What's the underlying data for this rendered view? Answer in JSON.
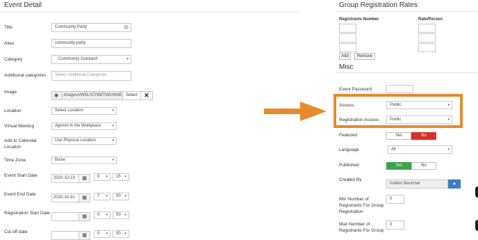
{
  "event_detail": {
    "heading": "Event Detail",
    "title_label": "Title",
    "title_value": "Community Party",
    "alias_label": "Alias",
    "alias_value": "community-party",
    "category_label": "Category",
    "category_value": "Community Outreach",
    "additional_label": "Additional categories",
    "additional_placeholder": "Select Additional Categories",
    "image_label": "Image",
    "image_value": "images/vWDLN7r9MTMGrWdE",
    "image_select": "Select",
    "location_label": "Location",
    "location_value": "Select Location",
    "virtual_label": "Virtual Meeting",
    "virtual_value": "Ageism in the Workplace",
    "calendar_label_1": "Add to Calendar",
    "calendar_label_2": "Location",
    "calendar_value": "Use Physical Location",
    "timezone_label": "Time Zone",
    "timezone_value": "Boise",
    "start_label": "Event Start Date",
    "start_date": "2020-10-19",
    "start_hour": "9",
    "start_min": "15",
    "end_label": "Event End Date",
    "end_date": "2020-10-31",
    "end_hour": "7",
    "end_min": "00",
    "reg_start_label": "Registration Start Date",
    "reg_start_hour": "0",
    "reg_start_min": "00",
    "cutoff_label": "Cut off date",
    "cutoff_hour": "0",
    "cutoff_min": "00"
  },
  "group_rates": {
    "heading": "Group Registration Rates",
    "col_number": "Registrants Number",
    "col_rate": "Rate/Person",
    "add_label": "Add",
    "remove_label": "Remove"
  },
  "misc": {
    "heading": "Misc",
    "password_label": "Event Password",
    "access_label": "Access",
    "access_value": "Public",
    "reg_access_label": "Registration Access",
    "reg_access_value": "Public",
    "featured_label": "Featured",
    "featured_yes": "Yes",
    "featured_no": "No",
    "language_label": "Language",
    "language_value": "All",
    "published_label": "Published",
    "published_yes": "Yes",
    "published_no": "No",
    "created_label": "Created By",
    "created_value": "holden blackmer",
    "min_label_1": "Min Number of",
    "min_label_2": "Registrants For Group",
    "min_label_3": "Registration",
    "min_value": "0",
    "max_label_1": "Max Number of",
    "max_label_2": "Registrants For Group",
    "max_value": "0"
  },
  "colors": {
    "highlight": "#e8892b",
    "yes_green": "#3fa34d",
    "no_red": "#d9302c",
    "user_blue": "#3a7fc1"
  }
}
